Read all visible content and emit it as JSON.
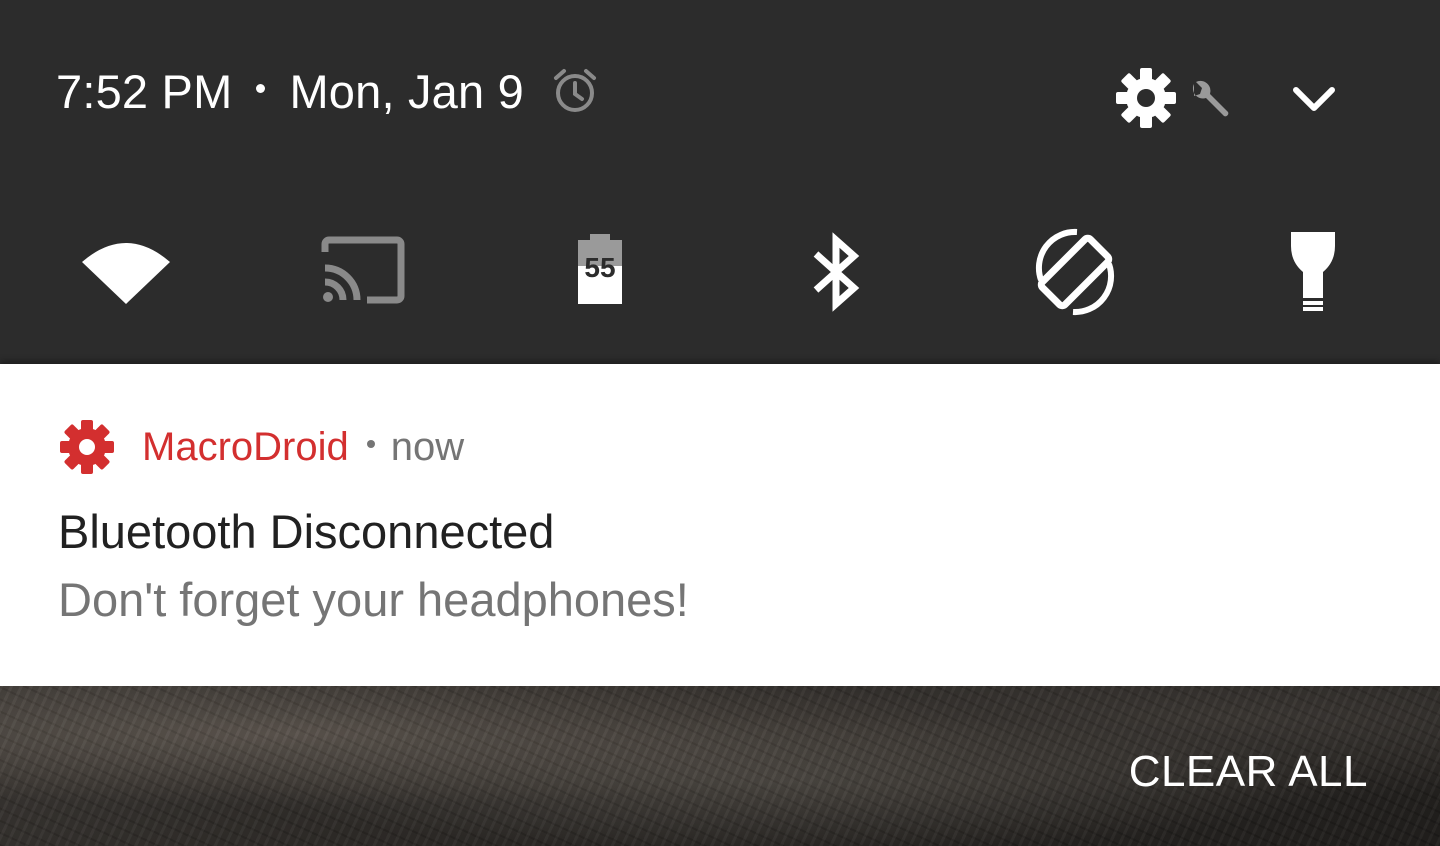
{
  "status": {
    "time": "7:52 PM",
    "date": "Mon, Jan 9"
  },
  "quick_settings": {
    "tiles": [
      {
        "name": "wifi",
        "icon": "wifi-icon"
      },
      {
        "name": "cast",
        "icon": "cast-icon"
      },
      {
        "name": "battery",
        "icon": "battery-icon",
        "level_text": "55"
      },
      {
        "name": "bluetooth",
        "icon": "bluetooth-icon"
      },
      {
        "name": "auto-rotate",
        "icon": "auto-rotate-icon"
      },
      {
        "name": "hue-light",
        "icon": "light-bulb-icon"
      }
    ]
  },
  "notification": {
    "app_name": "MacroDroid",
    "time": "now",
    "title": "Bluetooth Disconnected",
    "text": "Don't forget your headphones!"
  },
  "actions": {
    "clear_all": "CLEAR ALL"
  },
  "colors": {
    "shade_bg": "#2c2c2c",
    "app_accent": "#d32f2f",
    "secondary_text": "#757575"
  }
}
